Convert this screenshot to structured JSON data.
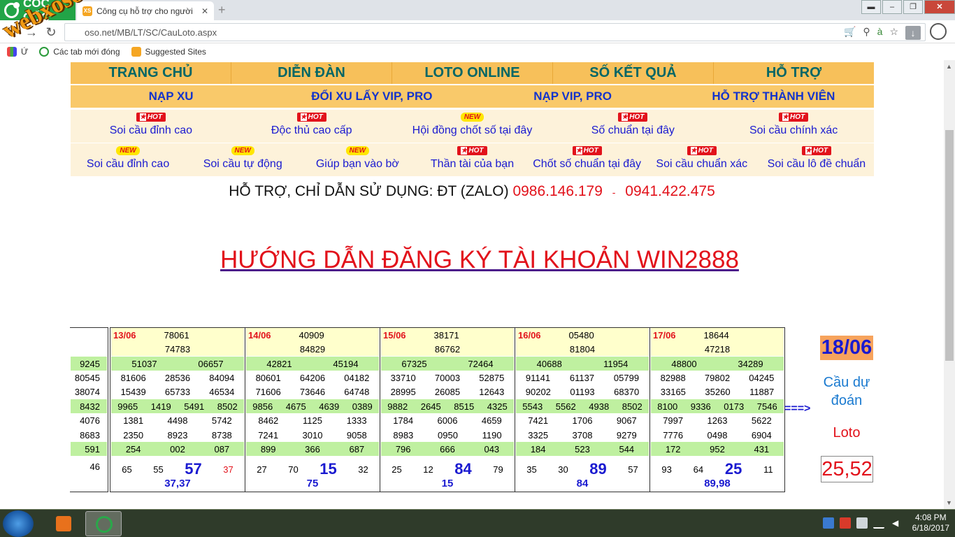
{
  "browser": {
    "brand": "CỐC CỐC",
    "tab_title": "Công cụ hỗ trợ cho người",
    "tab_favicon": "XS",
    "address": "webxoso.net/MB/LT/SC/CauLoto.aspx",
    "address_visible": "oso.net/MB/LT/SC/CauLoto.aspx",
    "bookmarks": [
      {
        "label": "Ứ",
        "icon": "apps-icon"
      },
      {
        "label": "Các tab mới đóng",
        "icon": "recent-tabs-icon"
      },
      {
        "label": "Suggested Sites",
        "icon": "suggested-sites-icon"
      }
    ]
  },
  "watermark": "webxoso.net",
  "menu": {
    "main": [
      "TRANG CHỦ",
      "DIỄN ĐÀN",
      "LOTO ONLINE",
      "SỐ KẾT QUẢ",
      "HỖ TRỢ"
    ],
    "secondary": [
      "NẠP XU",
      "ĐỔI XU LẤY VIP, PRO",
      "NẠP VIP, PRO",
      "HỖ TRỢ THÀNH VIÊN"
    ],
    "row3": [
      {
        "badge": "HOT",
        "label": "Soi cầu đỉnh cao"
      },
      {
        "badge": "HOT",
        "label": "Độc thủ cao cấp"
      },
      {
        "badge": "NEW",
        "label": "Hội đồng chốt số tại đây"
      },
      {
        "badge": "HOT",
        "label": "Số chuẩn tại đây"
      },
      {
        "badge": "HOT",
        "label": "Soi cầu chính xác"
      }
    ],
    "row4": [
      {
        "badge": "NEW",
        "label": "Soi cầu đỉnh cao"
      },
      {
        "badge": "NEW",
        "label": "Soi cầu tự động"
      },
      {
        "badge": "NEW",
        "label": "Giúp bạn vào bờ"
      },
      {
        "badge": "HOT",
        "label": "Thần tài của bạn"
      },
      {
        "badge": "HOT",
        "label": "Chốt số chuẩn tại đây"
      },
      {
        "badge": "HOT",
        "label": "Soi cầu chuẩn xác"
      },
      {
        "badge": "HOT",
        "label": "Soi cầu lô đề chuẩn"
      }
    ]
  },
  "support": {
    "text": "HỖ TRỢ, CHỈ DẪN SỬ DỤNG: ĐT (ZALO)",
    "phone1": "0986.146.179",
    "separator": "-",
    "phone2": "0941.422.475"
  },
  "heading": "HƯỚNG DẪN ĐĂNG KÝ TÀI KHOẢN WIN2888",
  "partial_card": {
    "rows": [
      [
        "9245"
      ],
      [
        "80545"
      ],
      [
        "38074"
      ],
      [
        "8432"
      ],
      [
        "4076"
      ],
      [
        "8683"
      ],
      [
        "591"
      ],
      [
        "46"
      ]
    ]
  },
  "results": [
    {
      "date": "13/06",
      "special": "78061",
      "first": "74783",
      "g2": [
        "51037",
        "06657"
      ],
      "g3a": [
        "81606",
        "28536",
        "84094"
      ],
      "g3b": [
        "15439",
        "65733",
        "46534"
      ],
      "g4": [
        "9965",
        "1419",
        "5491",
        "8502"
      ],
      "g5a": [
        "1381",
        "4498",
        "5742"
      ],
      "g5b": [
        "2350",
        "8923",
        "8738"
      ],
      "g6": [
        "254",
        "002",
        "087"
      ],
      "g7": [
        "65",
        "55",
        "57",
        "37"
      ],
      "big": "57",
      "sum": "37,37"
    },
    {
      "date": "14/06",
      "special": "40909",
      "first": "84829",
      "g2": [
        "42821",
        "45194"
      ],
      "g3a": [
        "80601",
        "64206",
        "04182"
      ],
      "g3b": [
        "71606",
        "73646",
        "64748"
      ],
      "g4": [
        "9856",
        "4675",
        "4639",
        "0389"
      ],
      "g5a": [
        "8462",
        "1125",
        "1333"
      ],
      "g5b": [
        "7241",
        "3010",
        "9058"
      ],
      "g6": [
        "899",
        "366",
        "687"
      ],
      "g7": [
        "27",
        "70",
        "15",
        "32"
      ],
      "big": "15",
      "sum": "75"
    },
    {
      "date": "15/06",
      "special": "38171",
      "first": "86762",
      "g2": [
        "67325",
        "72464"
      ],
      "g3a": [
        "33710",
        "70003",
        "52875"
      ],
      "g3b": [
        "28995",
        "26085",
        "12643"
      ],
      "g4": [
        "9882",
        "2645",
        "8515",
        "4325"
      ],
      "g5a": [
        "1784",
        "6006",
        "4659"
      ],
      "g5b": [
        "8983",
        "0950",
        "1190"
      ],
      "g6": [
        "796",
        "666",
        "043"
      ],
      "g7": [
        "25",
        "12",
        "84",
        "79"
      ],
      "big": "84",
      "sum": "15"
    },
    {
      "date": "16/06",
      "special": "05480",
      "first": "81804",
      "g2": [
        "40688",
        "11954"
      ],
      "g3a": [
        "91141",
        "61137",
        "05799"
      ],
      "g3b": [
        "90202",
        "01193",
        "68370"
      ],
      "g4": [
        "5543",
        "5562",
        "4938",
        "8502"
      ],
      "g5a": [
        "7421",
        "1706",
        "9067"
      ],
      "g5b": [
        "3325",
        "3708",
        "9279"
      ],
      "g6": [
        "184",
        "523",
        "544"
      ],
      "g7": [
        "35",
        "30",
        "89",
        "57"
      ],
      "big": "89",
      "sum": "84"
    },
    {
      "date": "17/06",
      "special": "18644",
      "first": "47218",
      "g2": [
        "48800",
        "34289"
      ],
      "g3a": [
        "82988",
        "79802",
        "04245"
      ],
      "g3b": [
        "33165",
        "35260",
        "11887"
      ],
      "g4": [
        "8100",
        "9336",
        "0173",
        "7546"
      ],
      "g5a": [
        "7997",
        "1263",
        "5622"
      ],
      "g5b": [
        "7776",
        "0498",
        "6904"
      ],
      "g6": [
        "172",
        "952",
        "431"
      ],
      "g7": [
        "93",
        "64",
        "25",
        "11"
      ],
      "big": "25",
      "sum": "89,98"
    }
  ],
  "prediction": {
    "arrow": "===>",
    "date": "18/06",
    "label_line1": "Cầu dự",
    "label_line2": "đoán",
    "loto_label": "Loto",
    "value": "25,52"
  },
  "taskbar": {
    "time": "4:08 PM",
    "date": "6/18/2017"
  },
  "colors": {
    "menu_bg": "#f7c05a",
    "link": "#1a1ad0",
    "accent_red": "#e2121b",
    "green_row": "#bff0a0",
    "yellow_row": "#ffffcc"
  }
}
